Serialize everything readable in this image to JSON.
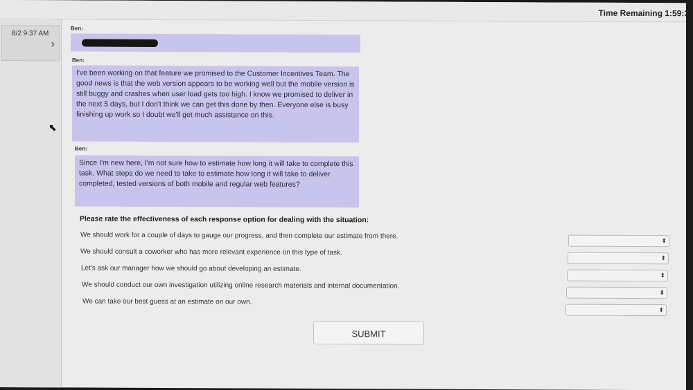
{
  "header": {
    "timer": "Time Remaining 1:59:3"
  },
  "sidebar": {
    "conversation": {
      "timestamp": "8/2 9:37 AM",
      "chevron": "chevron-right-icon"
    }
  },
  "messages": [
    {
      "sender": "Ben:",
      "text": ""
    },
    {
      "sender": "Ben:",
      "text": "I've been working on that feature we promised to the Customer Incentives Team. The good news is that the web version appears to be working well but the mobile version is still buggy and crashes when user load gets too high. I know we promised to deliver in the next 5 days, but I don't think we can get this done by then. Everyone else is busy finishing up work so I doubt we'll get much assistance on this."
    },
    {
      "sender": "Ben:",
      "text": "Since I'm new here, I'm not sure how to estimate how long it will take to complete this task. What steps do we need to take to estimate how long it will take to deliver completed, tested versions of both mobile and regular web features?"
    }
  ],
  "question": {
    "prompt": "Please rate the effectiveness of each response option for dealing with the situation:",
    "options": [
      {
        "text": "We should work for a couple of days to gauge our progress, and then complete our estimate from there.",
        "rating": ""
      },
      {
        "text": "We should consult a coworker who has more relevant experience on this type of task.",
        "rating": ""
      },
      {
        "text": "Let's ask our manager how we should go about developing an estimate.",
        "rating": ""
      },
      {
        "text": "We should conduct our own investigation utilizing online research materials and internal documentation.",
        "rating": ""
      },
      {
        "text": "We can take our best guess at an estimate on our own.",
        "rating": ""
      }
    ]
  },
  "submit_label": "SUBMIT",
  "colors": {
    "bubble": "#c9c4ec",
    "background": "#ececec"
  }
}
